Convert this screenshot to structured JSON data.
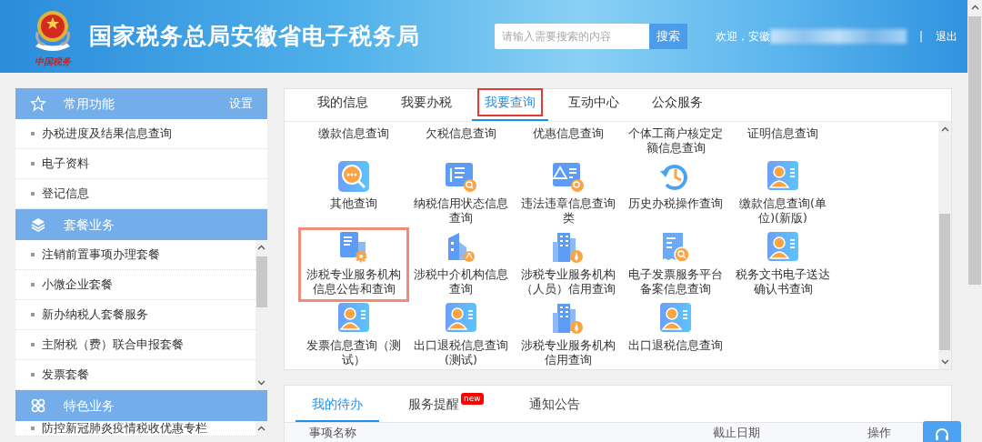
{
  "header": {
    "logo_caption": "中国税务",
    "title": "国家税务总局安徽省电子税务局",
    "search": {
      "placeholder": "请输入需要搜索的内容",
      "button": "搜索"
    },
    "welcome": "欢迎，安徽",
    "separator": "|",
    "logout": "退出"
  },
  "sidebar": {
    "sections": [
      {
        "title": "常用功能",
        "kind": "star",
        "action": "设置",
        "scrollable": false,
        "items": [
          "办税进度及结果信息查询",
          "电子资料",
          "登记信息"
        ]
      },
      {
        "title": "套餐业务",
        "kind": "layers",
        "scrollable": true,
        "items": [
          "注销前置事项办理套餐",
          "小微企业套餐",
          "新办纳税人套餐服务",
          "主附税（费）联合申报套餐",
          "发票套餐"
        ]
      },
      {
        "title": "特色业务",
        "kind": "clover",
        "scrollable": true,
        "items": [
          "防控新冠肺炎疫情税收优惠专栏"
        ]
      }
    ]
  },
  "main_panel": {
    "tabs": [
      {
        "label": "我的信息",
        "selected": false,
        "outlined": false
      },
      {
        "label": "我要办税",
        "selected": false,
        "outlined": false
      },
      {
        "label": "我要查询",
        "selected": true,
        "outlined": true
      },
      {
        "label": "互动中心",
        "selected": false,
        "outlined": false
      },
      {
        "label": "公众服务",
        "selected": false,
        "outlined": false
      }
    ],
    "service_rows": [
      [
        {
          "label": "缴款信息查询",
          "kind": "text",
          "outlined": false
        },
        {
          "label": "欠税信息查询",
          "kind": "text",
          "outlined": false
        },
        {
          "label": "优惠信息查询",
          "kind": "text",
          "outlined": false
        },
        {
          "label": "个体工商户核定定额信息查询",
          "kind": "text",
          "outlined": false
        },
        {
          "label": "证明信息查询",
          "kind": "text",
          "outlined": false
        }
      ],
      [
        {
          "label": "其他查询",
          "kind": "search",
          "outlined": false
        },
        {
          "label": "纳税信用状态信息查询",
          "kind": "credit",
          "outlined": false
        },
        {
          "label": "违法违章信息查询类",
          "kind": "warning",
          "outlined": false
        },
        {
          "label": "历史办税操作查询",
          "kind": "history",
          "outlined": false
        },
        {
          "label": "缴款信息查询(单位)(新版)",
          "kind": "person",
          "outlined": false
        }
      ],
      [
        {
          "label": "涉税专业服务机构信息公告和查询",
          "kind": "gear",
          "outlined": true
        },
        {
          "label": "涉税中介机构信息查询",
          "kind": "agent",
          "outlined": false
        },
        {
          "label": "涉税专业服务机构（人员）信用查询",
          "kind": "building",
          "outlined": false
        },
        {
          "label": "电子发票服务平台备案信息查询",
          "kind": "receipt",
          "outlined": false
        },
        {
          "label": "税务文书电子送达确认书查询",
          "kind": "person",
          "outlined": false
        }
      ],
      [
        {
          "label": "发票信息查询（测试）",
          "kind": "person",
          "outlined": false
        },
        {
          "label": "出口退税信息查询(测试)",
          "kind": "person",
          "outlined": false
        },
        {
          "label": "涉税专业服务机构信用查询",
          "kind": "building",
          "outlined": false
        },
        {
          "label": "出口退税信息查询",
          "kind": "person",
          "outlined": false
        }
      ]
    ]
  },
  "bottom_panel": {
    "tabs": [
      {
        "label": "我的待办",
        "selected": true
      },
      {
        "label": "服务提醒",
        "selected": false,
        "badge": "new"
      },
      {
        "label": "通知公告",
        "selected": false
      }
    ],
    "table": {
      "columns": [
        "事项名称",
        "截止日期",
        "操作"
      ]
    }
  }
}
